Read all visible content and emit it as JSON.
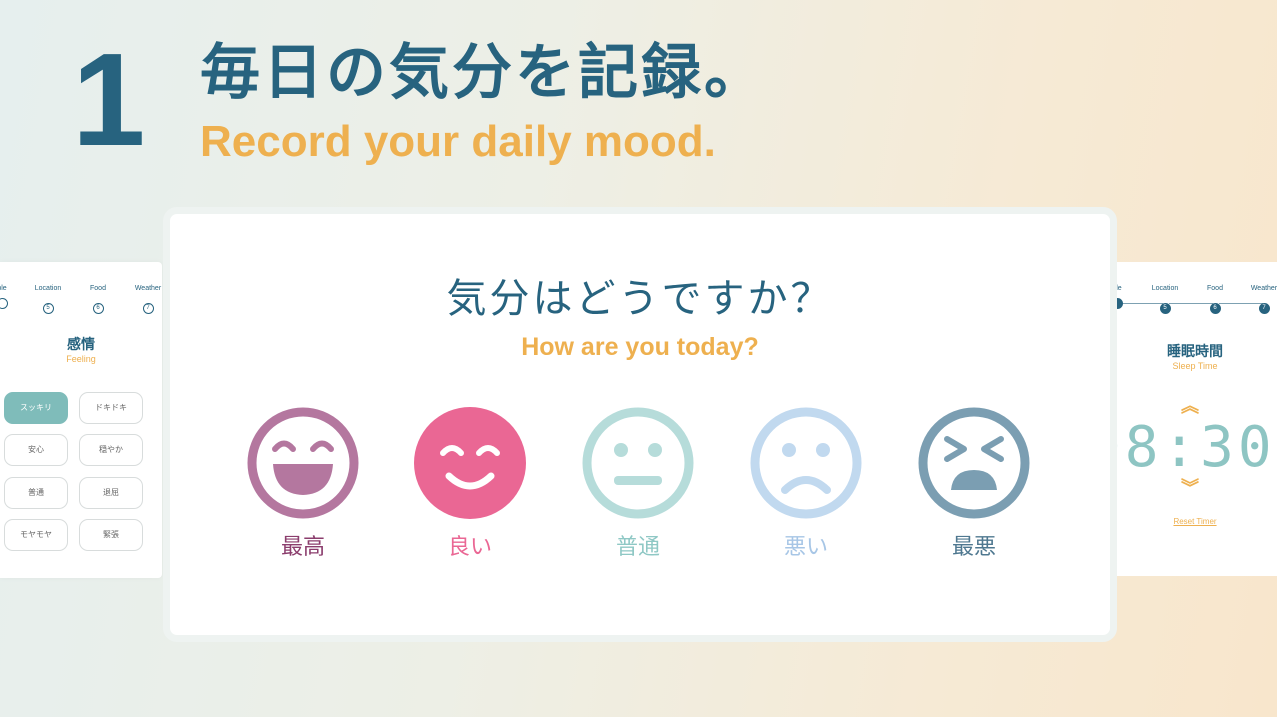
{
  "hero": {
    "step_number": "1",
    "title_jp": "毎日の気分を記録。",
    "title_en": "Record your daily mood."
  },
  "left_panel": {
    "steps": [
      {
        "label": "ple",
        "num": ""
      },
      {
        "label": "Location",
        "num": "5"
      },
      {
        "label": "Food",
        "num": "6"
      },
      {
        "label": "Weather",
        "num": "7"
      }
    ],
    "title": "感情",
    "subtitle": "Feeling",
    "chips": [
      "スッキリ",
      "ドキドキ",
      "安心",
      "穏やか",
      "普通",
      "退屈",
      "モヤモヤ",
      "緊張"
    ]
  },
  "right_panel": {
    "steps": [
      {
        "label": "ple",
        "num": ""
      },
      {
        "label": "Location",
        "num": "5"
      },
      {
        "label": "Food",
        "num": "6"
      },
      {
        "label": "Weather",
        "num": "7"
      }
    ],
    "title": "睡眠時間",
    "subtitle": "Sleep Time",
    "timer": "08:30",
    "reset_label": "Reset Timer"
  },
  "card": {
    "title": "気分はどうですか？",
    "subtitle": "How are you today?",
    "moods": [
      {
        "label": "最高",
        "icon": "laughing-face-icon",
        "color": "#b4779f",
        "label_color": "#8b3d6d"
      },
      {
        "label": "良い",
        "icon": "smiling-face-icon",
        "color": "#ea6794",
        "label_color": "#ea6794"
      },
      {
        "label": "普通",
        "icon": "neutral-face-icon",
        "color": "#b6dcda",
        "label_color": "#8fc8c5"
      },
      {
        "label": "悪い",
        "icon": "frowning-face-icon",
        "color": "#c1d9ef",
        "label_color": "#a7c6e6"
      },
      {
        "label": "最悪",
        "icon": "distressed-face-icon",
        "color": "#7b9eb2",
        "label_color": "#4f7890"
      }
    ]
  },
  "colors": {
    "brand_blue": "#27637f",
    "accent_orange": "#eeb04f",
    "teal": "#7fbcba"
  }
}
